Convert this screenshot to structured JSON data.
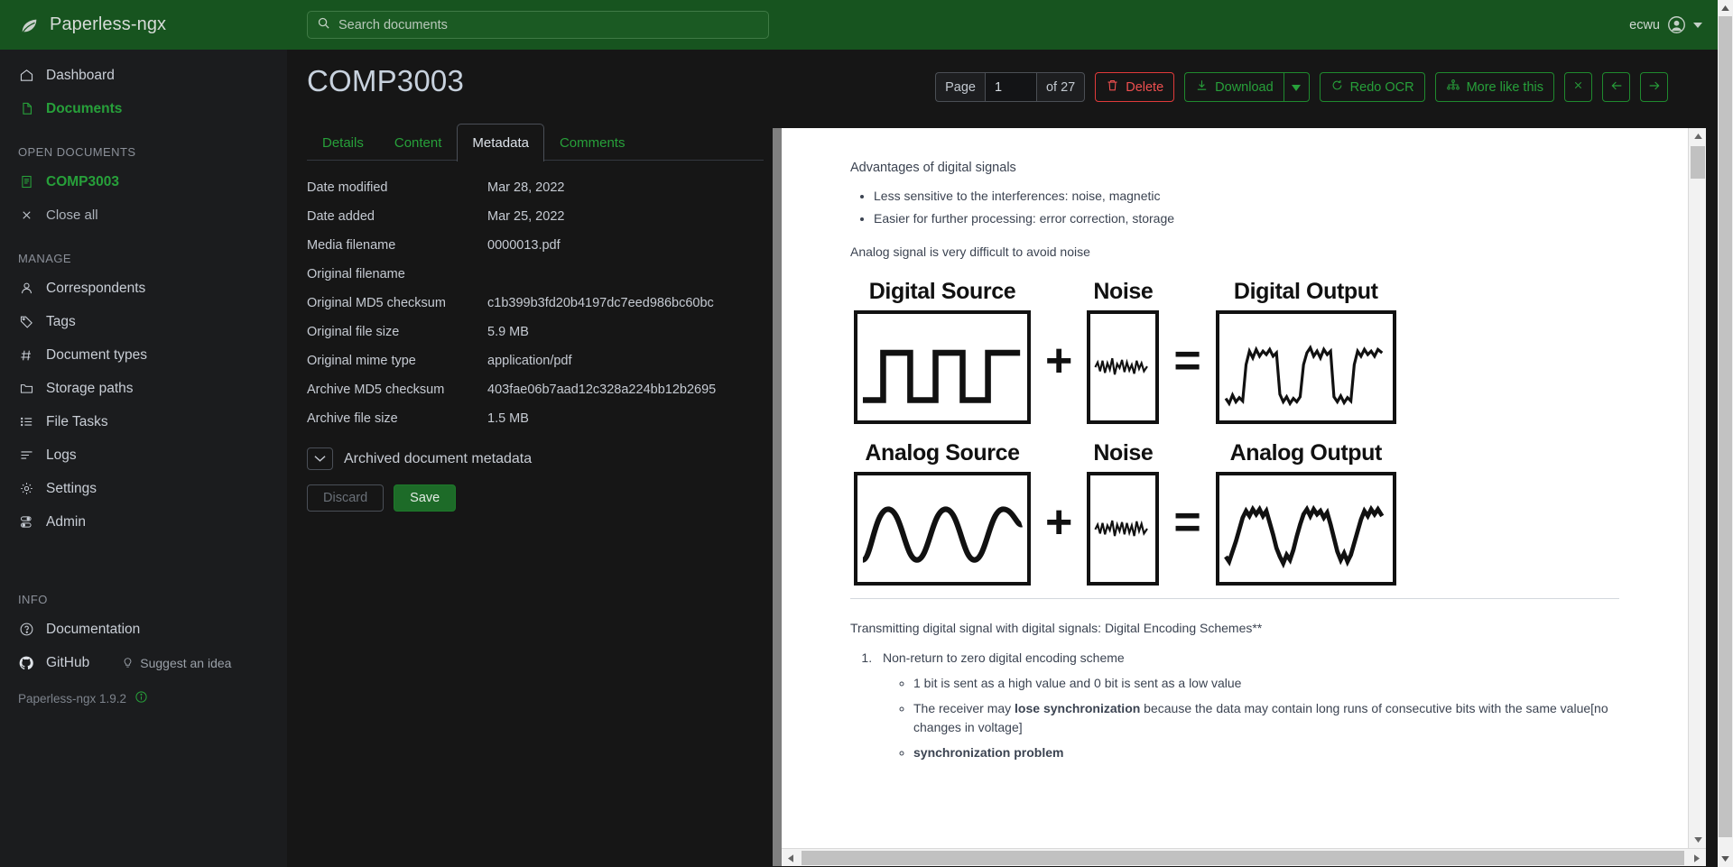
{
  "app": {
    "brand": "Paperless-ngx",
    "version_line": "Paperless-ngx 1.9.2",
    "accent_green": "#27a03a",
    "topbar_green": "#17541f"
  },
  "search": {
    "placeholder": "Search documents",
    "value": "",
    "icon": "search-icon"
  },
  "user": {
    "name": "ecwu",
    "avatar_icon": "user-circle-icon",
    "caret_icon": "chevron-down-icon"
  },
  "sidebar": {
    "primary": [
      {
        "label": "Dashboard",
        "icon": "home-icon",
        "active": false
      },
      {
        "label": "Documents",
        "icon": "document-icon",
        "active": true
      }
    ],
    "open_documents_heading": "OPEN DOCUMENTS",
    "open_documents": [
      {
        "label": "COMP3003",
        "icon": "file-text-icon",
        "active": true
      },
      {
        "label": "Close all",
        "icon": "close-icon",
        "active": false
      }
    ],
    "manage_heading": "MANAGE",
    "manage": [
      {
        "label": "Correspondents",
        "icon": "person-icon"
      },
      {
        "label": "Tags",
        "icon": "tag-icon"
      },
      {
        "label": "Document types",
        "icon": "hash-icon"
      },
      {
        "label": "Storage paths",
        "icon": "folder-icon"
      },
      {
        "label": "File Tasks",
        "icon": "list-task-icon"
      },
      {
        "label": "Logs",
        "icon": "lines-icon"
      },
      {
        "label": "Settings",
        "icon": "gear-icon"
      },
      {
        "label": "Admin",
        "icon": "toggles-icon"
      }
    ],
    "info_heading": "INFO",
    "info": [
      {
        "label": "Documentation",
        "icon": "question-circle-icon"
      }
    ],
    "github_label": "GitHub",
    "github_icon": "github-icon",
    "suggest_label": "Suggest an idea",
    "suggest_icon": "lightbulb-icon",
    "version_info_icon": "info-circle-icon"
  },
  "document": {
    "title": "COMP3003"
  },
  "toolbar": {
    "page_label": "Page",
    "page_value": "1",
    "page_total": "of 27",
    "delete_label": "Delete",
    "delete_icon": "trash-icon",
    "download_label": "Download",
    "download_icon": "download-icon",
    "download_caret_icon": "caret-down-icon",
    "redo_ocr_label": "Redo OCR",
    "redo_ocr_icon": "refresh-icon",
    "more_like_this_label": "More like this",
    "more_like_this_icon": "diagram-icon",
    "close_icon": "close-icon",
    "prev_icon": "arrow-left-icon",
    "next_icon": "arrow-right-icon"
  },
  "detail": {
    "tabs": [
      {
        "label": "Details",
        "selected": false
      },
      {
        "label": "Content",
        "selected": false
      },
      {
        "label": "Metadata",
        "selected": true
      },
      {
        "label": "Comments",
        "selected": false
      }
    ],
    "metadata_rows": [
      {
        "key": "Date modified",
        "value": "Mar 28, 2022"
      },
      {
        "key": "Date added",
        "value": "Mar 25, 2022"
      },
      {
        "key": "Media filename",
        "value": "0000013.pdf"
      },
      {
        "key": "Original filename",
        "value": ""
      },
      {
        "key": "Original MD5 checksum",
        "value": "c1b399b3fd20b4197dc7eed986bc60bc"
      },
      {
        "key": "Original file size",
        "value": "5.9 MB"
      },
      {
        "key": "Original mime type",
        "value": "application/pdf"
      },
      {
        "key": "Archive MD5 checksum",
        "value": "403fae06b7aad12c328a224bb12b2695"
      },
      {
        "key": "Archive file size",
        "value": "1.5 MB"
      }
    ],
    "archived_section_label": "Archived document metadata",
    "archived_chevron_icon": "chevron-down-icon",
    "discard_label": "Discard",
    "save_label": "Save"
  },
  "pdf": {
    "heading": "Advantages of digital signals",
    "bullets": [
      "Less sensitive to the interferences: noise, magnetic",
      "Easier for further processing: error correction, storage"
    ],
    "paragraph": "Analog signal is very difficult to avoid noise",
    "figure": {
      "rows": [
        {
          "source": "Digital Source",
          "noise": "Noise",
          "output": "Digital Output",
          "plus": "+",
          "equals": "="
        },
        {
          "source": "Analog Source",
          "noise": "Noise",
          "output": "Analog Output",
          "plus": "+",
          "equals": "="
        }
      ]
    },
    "section2_title": "Transmitting digital signal with digital signals: Digital Encoding Schemes**",
    "ordered": [
      {
        "text": "Non-return to zero digital encoding scheme",
        "sub": [
          {
            "pre": "1 bit is sent as a high value and 0 bit is sent as a low value",
            "bold": "",
            "post": ""
          },
          {
            "pre": "The receiver may ",
            "bold": "lose synchronization",
            "post": " because the data may contain long runs of consecutive bits with the same value[no changes in voltage]"
          },
          {
            "pre": "",
            "bold": "synchronization problem",
            "post": ""
          }
        ]
      }
    ]
  }
}
